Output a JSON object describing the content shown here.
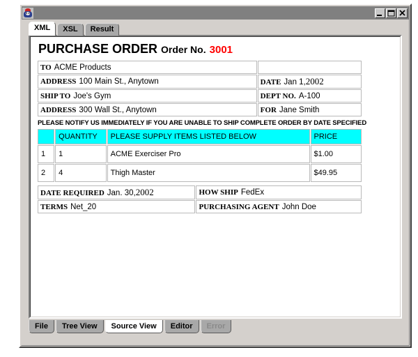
{
  "window": {
    "title": "",
    "icon": "java-duke-icon",
    "buttons": {
      "minimize": "minimize-icon",
      "maximize": "maximize-icon",
      "close": "close-icon"
    }
  },
  "top_tabs": [
    {
      "label": "XML",
      "selected": true
    },
    {
      "label": "XSL",
      "selected": false
    },
    {
      "label": "Result",
      "selected": false
    }
  ],
  "bottom_tabs": [
    {
      "label": "File",
      "selected": false,
      "disabled": false
    },
    {
      "label": "Tree View",
      "selected": false,
      "disabled": false
    },
    {
      "label": "Source View",
      "selected": true,
      "disabled": false
    },
    {
      "label": "Editor",
      "selected": false,
      "disabled": false
    },
    {
      "label": "Error",
      "selected": false,
      "disabled": true
    }
  ],
  "purchase_order": {
    "title": "PURCHASE ORDER",
    "order_no_label": "Order No.",
    "order_no_value": "3001",
    "order_no_color": "#ff0000",
    "header_rows": [
      {
        "label": "TO",
        "value": "ACME Products",
        "right_label": "",
        "right_value": ""
      },
      {
        "label": "ADDRESS",
        "value": "100 Main St., Anytown",
        "right_label": "DATE",
        "right_value": "Jan 1,",
        "right_value_serif": "2002"
      },
      {
        "label": "SHIP TO",
        "value": "Joe's Gym",
        "right_label": "DEPT NO.",
        "right_value": "A-100",
        "right_value_serif": ""
      },
      {
        "label": "ADDRESS",
        "value": "300 Wall St., Anytown",
        "right_label": "FOR",
        "right_value": "Jane Smith",
        "right_value_serif": ""
      }
    ],
    "notice": "PLEASE NOTIFY US IMMEDIATELY IF YOU ARE UNABLE TO SHIP COMPLETE ORDER BY DATE SPECIFIED",
    "items_table": {
      "header_bg": "#00ffff",
      "columns": [
        "",
        "QUANTITY",
        "PLEASE SUPPLY ITEMS LISTED BELOW",
        "PRICE"
      ],
      "rows": [
        {
          "num": "1",
          "quantity": "1",
          "description": "ACME Exerciser Pro",
          "price": "$1.00"
        },
        {
          "num": "2",
          "quantity": "4",
          "description": "Thigh Master",
          "price": "$49.95"
        }
      ]
    },
    "footer_rows": [
      {
        "left_label": "DATE REQUIRED",
        "left_value": "Jan. 30,",
        "left_value_serif": "2002",
        "right_label": "HOW SHIP",
        "right_value": "FedEx"
      },
      {
        "left_label": "TERMS",
        "left_value": "Net_20",
        "left_value_serif": "",
        "right_label": "PURCHASING AGENT",
        "right_value": "John Doe"
      }
    ]
  }
}
